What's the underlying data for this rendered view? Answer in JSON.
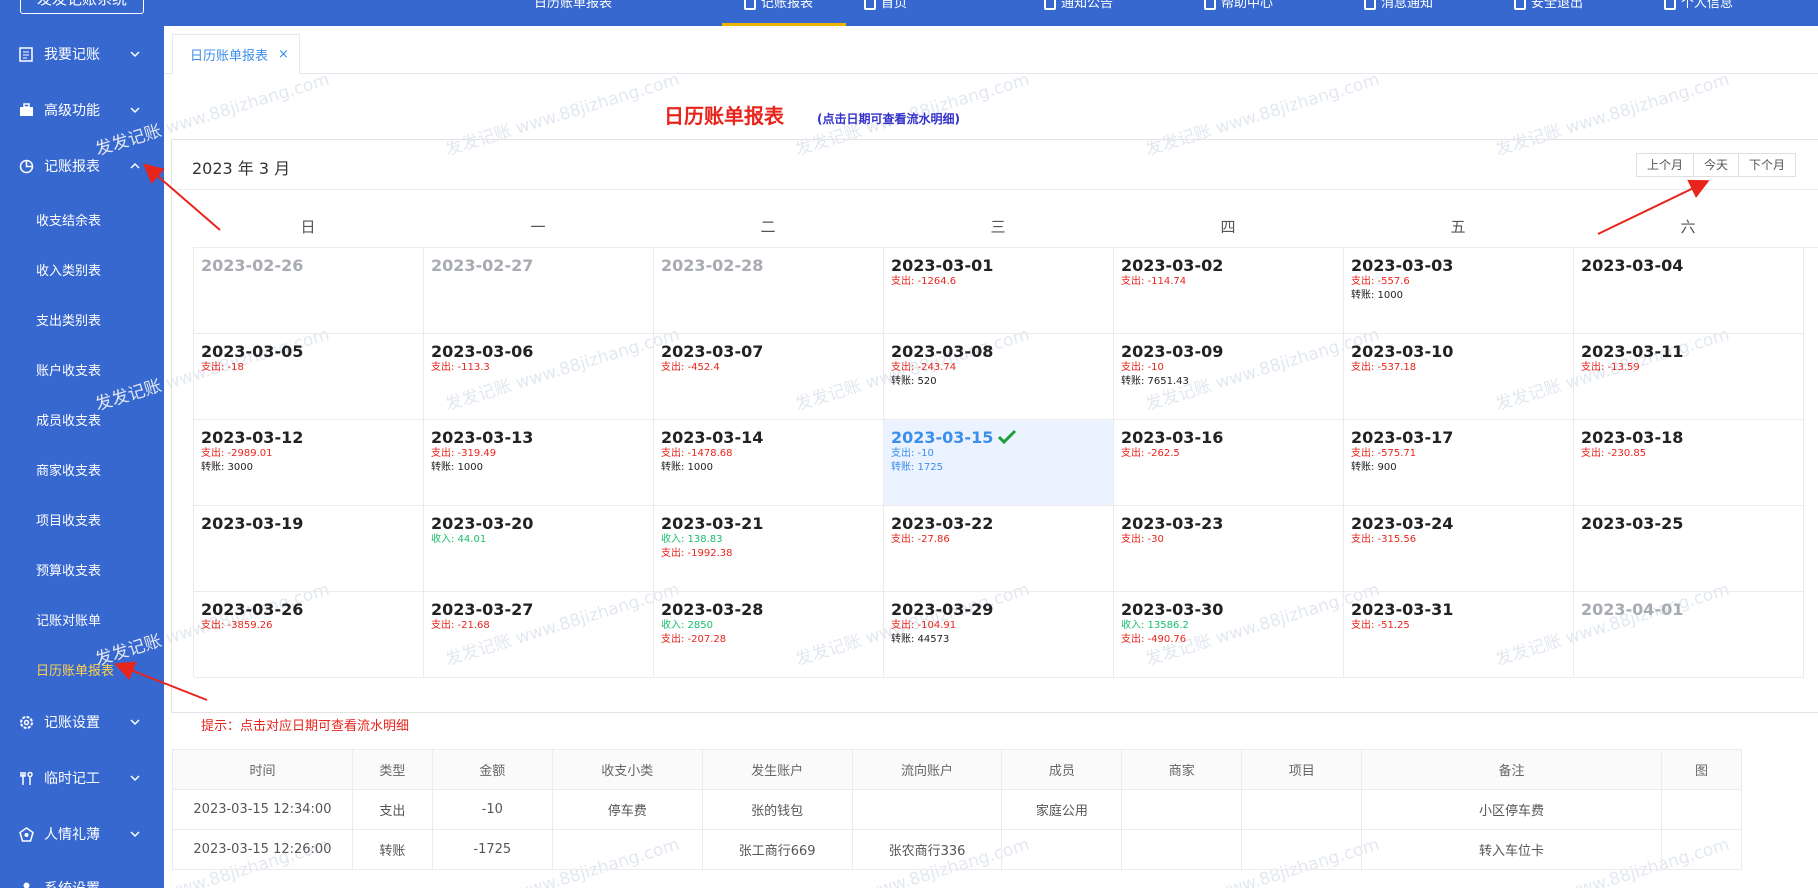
{
  "app": {
    "logo": "发发记账系统"
  },
  "topbar": {
    "items": [
      "日历账单报表",
      "记账报表",
      "首页",
      "通知公告",
      "帮助中心",
      "消息通知",
      "安全退出",
      "个人信息"
    ]
  },
  "sidebar": {
    "main": [
      {
        "label": "我要记账",
        "icon": "document-icon",
        "expanded": false
      },
      {
        "label": "高级功能",
        "icon": "briefcase-icon",
        "expanded": false
      },
      {
        "label": "记账报表",
        "icon": "pie-chart-icon",
        "expanded": true
      },
      {
        "label": "记账设置",
        "icon": "gear-icon",
        "expanded": false
      },
      {
        "label": "临时记工",
        "icon": "tools-icon",
        "expanded": false
      },
      {
        "label": "人情礼薄",
        "icon": "gift-icon",
        "expanded": false
      },
      {
        "label": "系统设置",
        "icon": "user-icon",
        "expanded": false
      }
    ],
    "sub": [
      "收支结余表",
      "收入类别表",
      "支出类别表",
      "账户收支表",
      "成员收支表",
      "商家收支表",
      "项目收支表",
      "预算收支表",
      "记账对账单",
      "日历账单报表"
    ],
    "active_sub": "日历账单报表"
  },
  "tabs": [
    {
      "label": "日历账单报表",
      "close": "×"
    }
  ],
  "page": {
    "title": "日历账单报表",
    "hint": "(点击日期可查看流水明细)",
    "tip": "提示：点击对应日期可查看流水明细"
  },
  "calendar": {
    "month_label": "2023 年 3 月",
    "buttons": [
      "上个月",
      "今天",
      "下个月"
    ],
    "weekdays": [
      "日",
      "一",
      "二",
      "三",
      "四",
      "五",
      "六"
    ],
    "selected": "2023-03-15",
    "days": [
      {
        "date": "2023-02-26",
        "other": true,
        "lines": []
      },
      {
        "date": "2023-02-27",
        "other": true,
        "lines": []
      },
      {
        "date": "2023-02-28",
        "other": true,
        "lines": []
      },
      {
        "date": "2023-03-01",
        "lines": [
          [
            "exp",
            "支出: -1264.6"
          ]
        ]
      },
      {
        "date": "2023-03-02",
        "lines": [
          [
            "exp",
            "支出: -114.74"
          ]
        ]
      },
      {
        "date": "2023-03-03",
        "lines": [
          [
            "exp",
            "支出: -557.6"
          ],
          [
            "trn",
            "转账: 1000"
          ]
        ]
      },
      {
        "date": "2023-03-04",
        "lines": []
      },
      {
        "date": "2023-03-05",
        "lines": [
          [
            "exp",
            "支出: -18"
          ]
        ]
      },
      {
        "date": "2023-03-06",
        "lines": [
          [
            "exp",
            "支出: -113.3"
          ]
        ]
      },
      {
        "date": "2023-03-07",
        "lines": [
          [
            "exp",
            "支出: -452.4"
          ]
        ]
      },
      {
        "date": "2023-03-08",
        "lines": [
          [
            "exp",
            "支出: -243.74"
          ],
          [
            "trn",
            "转账: 520"
          ]
        ]
      },
      {
        "date": "2023-03-09",
        "lines": [
          [
            "exp",
            "支出: -10"
          ],
          [
            "trn",
            "转账: 7651.43"
          ]
        ]
      },
      {
        "date": "2023-03-10",
        "lines": [
          [
            "exp",
            "支出: -537.18"
          ]
        ]
      },
      {
        "date": "2023-03-11",
        "lines": [
          [
            "exp",
            "支出: -13.59"
          ]
        ]
      },
      {
        "date": "2023-03-12",
        "lines": [
          [
            "exp",
            "支出: -2989.01"
          ],
          [
            "trn",
            "转账: 3000"
          ]
        ]
      },
      {
        "date": "2023-03-13",
        "lines": [
          [
            "exp",
            "支出: -319.49"
          ],
          [
            "trn",
            "转账: 1000"
          ]
        ]
      },
      {
        "date": "2023-03-14",
        "lines": [
          [
            "exp",
            "支出: -1478.68"
          ],
          [
            "trn",
            "转账: 1000"
          ]
        ]
      },
      {
        "date": "2023-03-15",
        "lines": [
          [
            "exp",
            "支出: -10"
          ],
          [
            "trn",
            "转账: 1725"
          ]
        ]
      },
      {
        "date": "2023-03-16",
        "lines": [
          [
            "exp",
            "支出: -262.5"
          ]
        ]
      },
      {
        "date": "2023-03-17",
        "lines": [
          [
            "exp",
            "支出: -575.71"
          ],
          [
            "trn",
            "转账: 900"
          ]
        ]
      },
      {
        "date": "2023-03-18",
        "lines": [
          [
            "exp",
            "支出: -230.85"
          ]
        ]
      },
      {
        "date": "2023-03-19",
        "lines": []
      },
      {
        "date": "2023-03-20",
        "lines": [
          [
            "inc",
            "收入: 44.01"
          ]
        ]
      },
      {
        "date": "2023-03-21",
        "lines": [
          [
            "inc",
            "收入: 138.83"
          ],
          [
            "exp",
            "支出: -1992.38"
          ]
        ]
      },
      {
        "date": "2023-03-22",
        "lines": [
          [
            "exp",
            "支出: -27.86"
          ]
        ]
      },
      {
        "date": "2023-03-23",
        "lines": [
          [
            "exp",
            "支出: -30"
          ]
        ]
      },
      {
        "date": "2023-03-24",
        "lines": [
          [
            "exp",
            "支出: -315.56"
          ]
        ]
      },
      {
        "date": "2023-03-25",
        "lines": []
      },
      {
        "date": "2023-03-26",
        "lines": [
          [
            "exp",
            "支出: -3859.26"
          ]
        ]
      },
      {
        "date": "2023-03-27",
        "lines": [
          [
            "exp",
            "支出: -21.68"
          ]
        ]
      },
      {
        "date": "2023-03-28",
        "lines": [
          [
            "inc",
            "收入: 2850"
          ],
          [
            "exp",
            "支出: -207.28"
          ]
        ]
      },
      {
        "date": "2023-03-29",
        "lines": [
          [
            "exp",
            "支出: -104.91"
          ],
          [
            "trn",
            "转账: 44573"
          ]
        ]
      },
      {
        "date": "2023-03-30",
        "lines": [
          [
            "inc",
            "收入: 13586.2"
          ],
          [
            "exp",
            "支出: -490.76"
          ]
        ]
      },
      {
        "date": "2023-03-31",
        "lines": [
          [
            "exp",
            "支出: -51.25"
          ]
        ]
      },
      {
        "date": "2023-04-01",
        "other": true,
        "lines": []
      }
    ]
  },
  "table": {
    "headers": [
      "时间",
      "类型",
      "金额",
      "收支小类",
      "发生账户",
      "流向账户",
      "成员",
      "商家",
      "项目",
      "备注",
      "图"
    ],
    "rows": [
      [
        "2023-03-15 12:34:00",
        "支出",
        "-10",
        "停车费",
        "张的钱包",
        "",
        "家庭公用",
        "",
        "",
        "小区停车费",
        ""
      ],
      [
        "2023-03-15 12:26:00",
        "转账",
        "-1725",
        "",
        "张工商行669",
        "张农商行336",
        "",
        "",
        "",
        "转入车位卡",
        ""
      ]
    ]
  },
  "watermark": "发发记账 www.88jizhang.com",
  "colors": {
    "sidebar": "#3768d0",
    "expense": "#e8251c",
    "income": "#19be6b",
    "link": "#3d8eea",
    "active_menu": "#ffd24a"
  }
}
